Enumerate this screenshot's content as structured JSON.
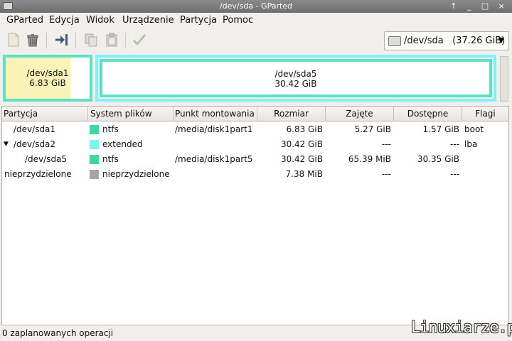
{
  "window": {
    "title": "/dev/sda - GParted"
  },
  "menu": [
    {
      "label": "GParted"
    },
    {
      "label": "Edycja"
    },
    {
      "label": "Widok"
    },
    {
      "label": "Urządzenie"
    },
    {
      "label": "Partycja"
    },
    {
      "label": "Pomoc"
    }
  ],
  "toolbar": {
    "icons": [
      "new-icon",
      "delete-icon",
      "resize-move-icon",
      "copy-icon",
      "paste-icon",
      "apply-icon"
    ],
    "device": {
      "name": "/dev/sda",
      "size": "(37.26 GiB)"
    }
  },
  "graphic": {
    "sda1": {
      "name": "/dev/sda1",
      "size": "6.83 GiB",
      "used_fraction": 0.77
    },
    "sda5": {
      "name": "/dev/sda5",
      "size": "30.42 GiB",
      "used_fraction": 0.0
    }
  },
  "columns": [
    "Partycja",
    "System plików",
    "Punkt montowania",
    "Rozmiar",
    "Zajęte",
    "Dostępne",
    "Flagi"
  ],
  "rows": [
    {
      "partition": "/dev/sda1",
      "fs": "ntfs",
      "fs_color": "#42d6a4",
      "mount": "/media/disk1part1",
      "size": "6.83 GiB",
      "used": "5.27 GiB",
      "free": "1.57 GiB",
      "flags": "boot"
    },
    {
      "partition": "/dev/sda2",
      "fs": "extended",
      "fs_color": "#80f2f2",
      "mount": "",
      "size": "30.42 GiB",
      "used": "---",
      "free": "---",
      "flags": "lba"
    },
    {
      "partition": "/dev/sda5",
      "fs": "ntfs",
      "fs_color": "#42d6a4",
      "mount": "/media/disk1part5",
      "size": "30.42 GiB",
      "used": "65.39 MiB",
      "free": "30.35 GiB",
      "flags": ""
    },
    {
      "partition": "nieprzydzielone",
      "fs": "nieprzydzielone",
      "fs_color": "#a6a6a6",
      "mount": "",
      "size": "7.38 MiB",
      "used": "---",
      "free": "---",
      "flags": ""
    }
  ],
  "status": "0 zaplanowanych operacji",
  "watermark": "Linuxiarze.pl"
}
